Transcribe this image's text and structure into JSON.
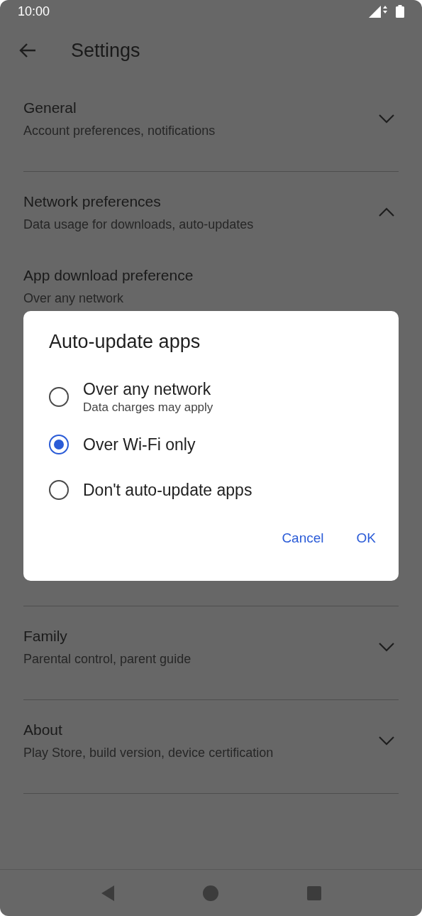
{
  "status_bar": {
    "time": "10:00"
  },
  "app_bar": {
    "title": "Settings"
  },
  "sections": [
    {
      "title": "General",
      "subtitle": "Account preferences, notifications",
      "expanded": false
    },
    {
      "title": "Network preferences",
      "subtitle": "Data usage for downloads, auto-updates",
      "expanded": true,
      "items": [
        {
          "title": "App download preference",
          "subtitle": "Over any network"
        }
      ]
    },
    {
      "title": "Family",
      "subtitle": "Parental control, parent guide",
      "expanded": false
    },
    {
      "title": "About",
      "subtitle": "Play Store, build version, device certification",
      "expanded": false
    }
  ],
  "dialog": {
    "title": "Auto-update apps",
    "options": [
      {
        "label": "Over any network",
        "hint": "Data charges may apply",
        "selected": false
      },
      {
        "label": "Over Wi-Fi only",
        "selected": true
      },
      {
        "label": "Don't auto-update apps",
        "selected": false
      }
    ],
    "buttons": [
      "Cancel",
      "OK"
    ]
  }
}
